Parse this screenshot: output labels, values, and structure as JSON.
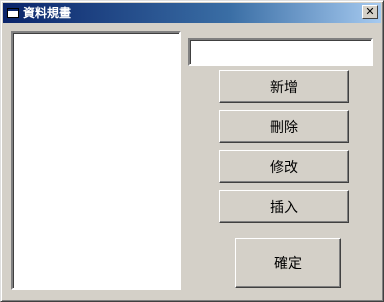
{
  "window": {
    "title": "資料規畫",
    "close_symbol": "✕"
  },
  "list": {
    "items": []
  },
  "input": {
    "value": "",
    "placeholder": ""
  },
  "buttons": {
    "add": "新增",
    "delete": "刪除",
    "modify": "修改",
    "insert": "插入",
    "ok": "確定"
  },
  "colors": {
    "face": "#d4d0c8",
    "title_start": "#0a246a",
    "title_end": "#a6caf0"
  }
}
